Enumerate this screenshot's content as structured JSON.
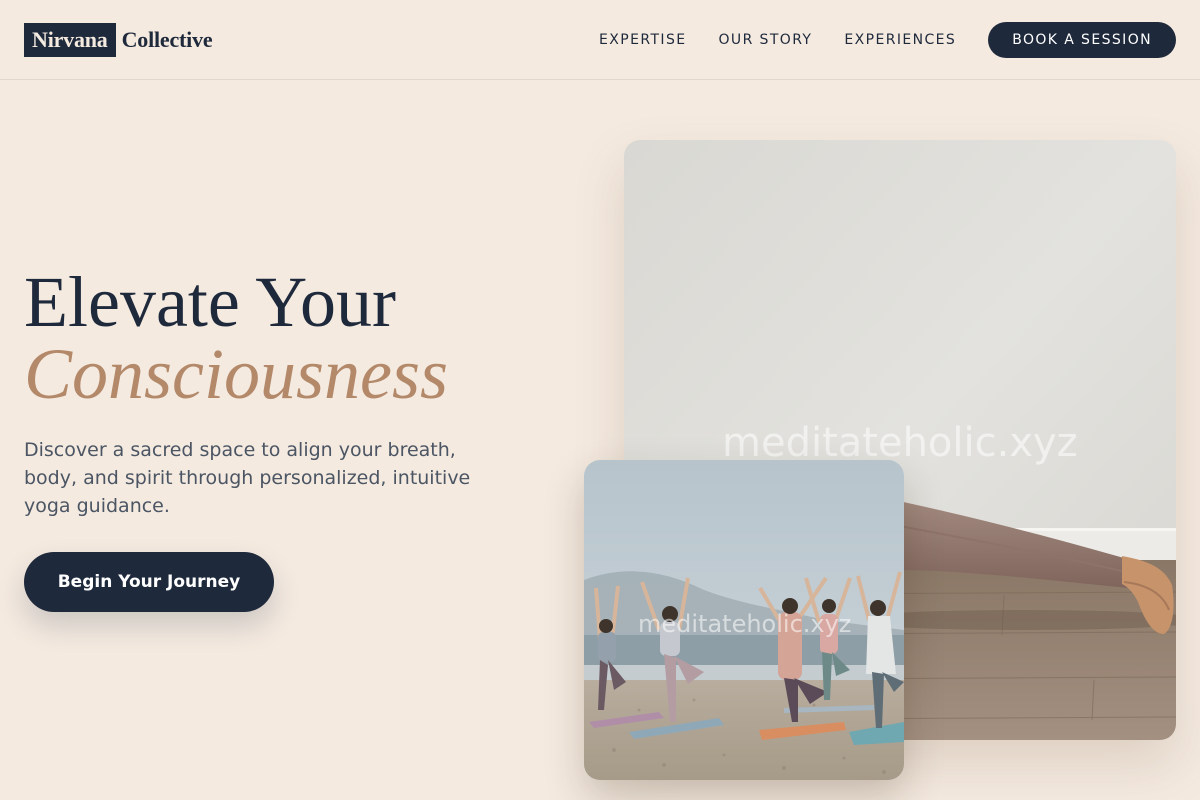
{
  "brand": {
    "logo_highlight": "Nirvana",
    "logo_rest": "Collective"
  },
  "nav": {
    "links": [
      "EXPERTISE",
      "OUR STORY",
      "EXPERIENCES"
    ],
    "cta": "BOOK A SESSION"
  },
  "hero": {
    "title_line1": "Elevate Your",
    "title_line2": "Consciousness",
    "description": "Discover a sacred space to align your breath, body, and spirit through personalized, intuitive yoga guidance.",
    "cta": "Begin Your Journey"
  },
  "images": {
    "large_watermark": "meditateholic.xyz",
    "small_watermark": "meditateholic.xyz"
  },
  "colors": {
    "background": "#f4eae0",
    "navy": "#1e293b",
    "accent": "#b3896a",
    "body_text": "#4b5563"
  }
}
